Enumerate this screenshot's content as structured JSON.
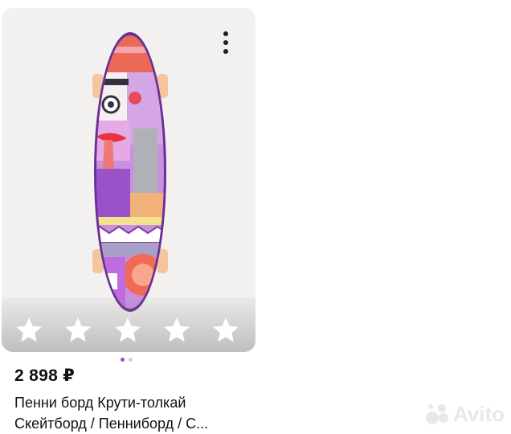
{
  "listing": {
    "price": "2 898 ₽",
    "title_line_1": "Пенни борд Крути-толкай",
    "title_line_2": "Скейтборд / Пенниборд / С..."
  },
  "gallery": {
    "total_images": 2,
    "active_index": 0,
    "rating_stars": 5,
    "rating_filled": 0
  },
  "watermark": {
    "text": "Avito"
  },
  "icons": {
    "more": "more-vertical-icon",
    "star": "star-outline-icon"
  },
  "colors": {
    "accent": "#a64ad9",
    "board_purple": "#7d3fa6",
    "background": "#f2f1f0"
  }
}
